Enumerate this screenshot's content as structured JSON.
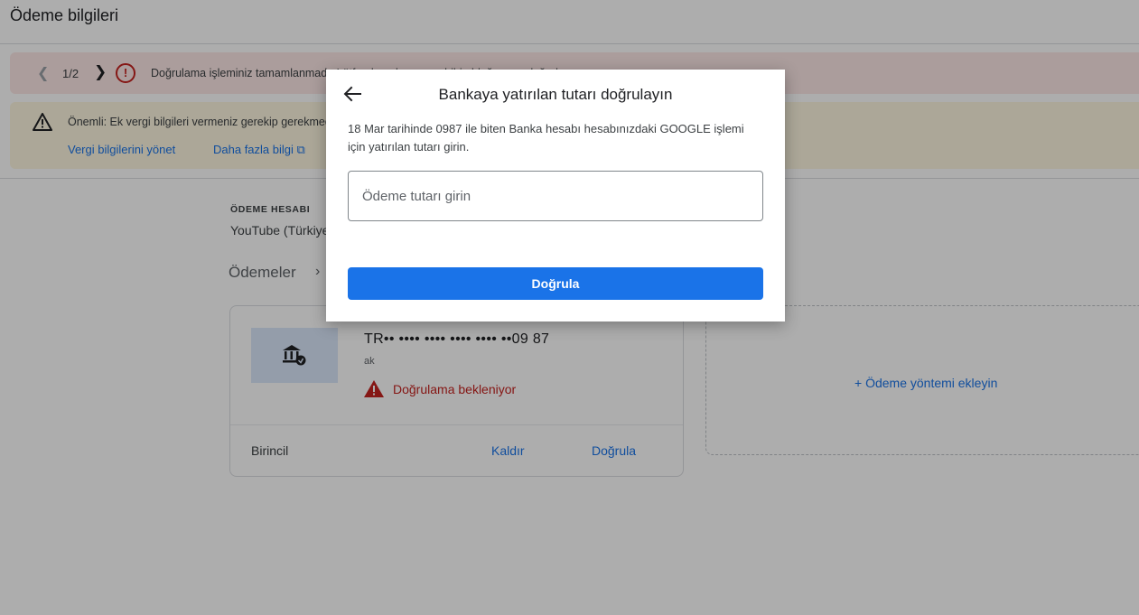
{
  "header": {
    "title": "Ödeme bilgileri"
  },
  "alerts": {
    "error": {
      "counter": "1/2",
      "message": "Doğrulama işleminiz tamamlanmadı. Lütfen hesabınızın sahibi olduğunuzu doğrulayın."
    },
    "warning": {
      "message": "Önemli: Ek vergi bilgileri vermeniz gerekip gerekmediğini kontrol edin. Gerekli vergilerin doğru hesaplanabilmesi için vergi bilgilerini gönderme",
      "link_manage": "Vergi bilgilerini yönet",
      "link_more": "Daha fazla bilgi"
    }
  },
  "account": {
    "label": "ÖDEME HESABI",
    "value": "YouTube (Türkiye)"
  },
  "breadcrumb": {
    "label": "Ödemeler"
  },
  "payment_method": {
    "account_number": "TR•• •••• •••• •••• •••• ••09 87",
    "sub": "ak",
    "status": "Doğrulama bekleniyor",
    "primary_label": "Birincil",
    "remove_label": "Kaldır",
    "verify_label": "Doğrula"
  },
  "add_method": {
    "label": "+ Ödeme yöntemi ekleyin"
  },
  "dialog": {
    "title": "Bankaya yatırılan tutarı doğrulayın",
    "description": "18 Mar tarihinde 0987 ile biten Banka hesabı hesabınızdaki GOOGLE işlemi için yatırılan tutarı girin.",
    "input_placeholder": "Ödeme tutarı girin",
    "input_value": "",
    "submit_label": "Doğrula"
  },
  "colors": {
    "accent": "#1a73e8",
    "error": "#c5221f",
    "error_bg": "#fce8e6",
    "warning_bg": "#fef7e0"
  }
}
